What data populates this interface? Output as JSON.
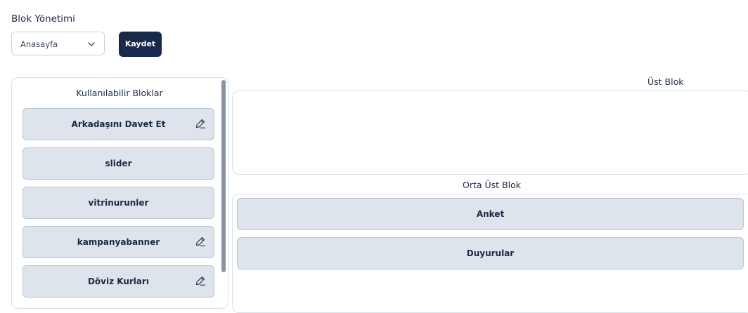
{
  "header": {
    "title": "Blok Yönetimi"
  },
  "page_select": {
    "value": "Anasayfa",
    "icon": "chevron-down-icon"
  },
  "save_button": {
    "label": "Kaydet",
    "color": "#172a4c"
  },
  "available": {
    "title": "Kullanılabilir Bloklar",
    "items": [
      {
        "label": "Arkadaşını Davet Et",
        "editable": true
      },
      {
        "label": "slider",
        "editable": false
      },
      {
        "label": "vitrinurunler",
        "editable": false
      },
      {
        "label": "kampanyabanner",
        "editable": true
      },
      {
        "label": "Döviz Kurları",
        "editable": true
      }
    ]
  },
  "ust_blok": {
    "title": "Üst Blok",
    "items": []
  },
  "orta_ust_blok": {
    "title": "Orta Üst Blok",
    "items": [
      {
        "label": "Anket"
      },
      {
        "label": "Duyurular"
      }
    ]
  }
}
